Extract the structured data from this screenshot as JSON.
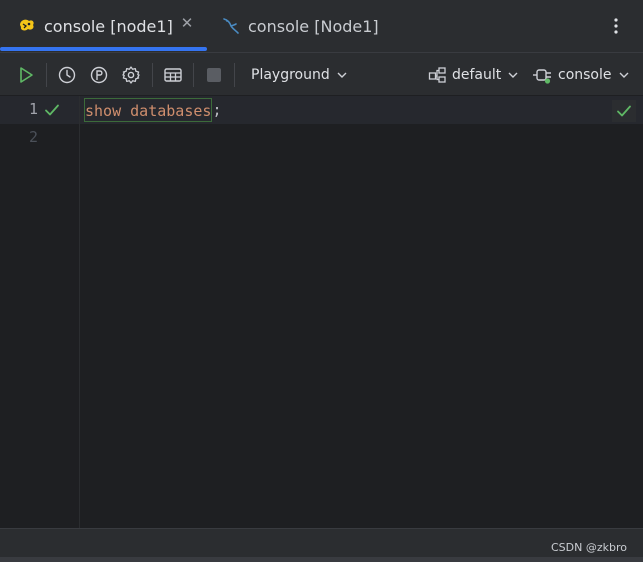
{
  "tabs": [
    {
      "label": "console [node1]",
      "icon": "hive-icon",
      "active": true
    },
    {
      "label": "console [Node1]",
      "icon": "mysql-dolphin-icon",
      "active": false
    }
  ],
  "toolbar": {
    "mode_label": "Playground",
    "schema_label": "default",
    "session_label": "console"
  },
  "editor": {
    "lines": [
      {
        "number": "1",
        "keyword": "show databases",
        "punct": ";"
      },
      {
        "number": "2"
      }
    ]
  },
  "status": {
    "watermark": "CSDN @zkbro"
  },
  "colors": {
    "accent": "#3574f0",
    "run_green": "#5fb865",
    "keyword": "#cf8e6d"
  }
}
